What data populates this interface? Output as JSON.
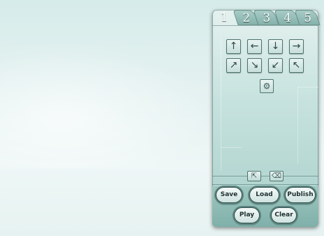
{
  "tabs": [
    {
      "label": "1",
      "active": true
    },
    {
      "label": "2",
      "active": false
    },
    {
      "label": "3",
      "active": false
    },
    {
      "label": "4",
      "active": false
    },
    {
      "label": "5",
      "active": false
    }
  ],
  "arrows": {
    "up": "↑",
    "left": "←",
    "down": "↓",
    "right": "→",
    "up_right": "↗",
    "down_right": "↘",
    "down_left": "↙",
    "up_left": "↖"
  },
  "tools": {
    "gear": "⚙",
    "reset": "⇱",
    "eraser": "⌫"
  },
  "buttons": {
    "save": "Save",
    "load": "Load",
    "publish": "Publish",
    "play": "Play",
    "clear": "Clear"
  },
  "colors": {
    "panel_border": "#4d726d",
    "pill_border": "#2f4f4b",
    "panel_bottom": "#7fb0a9"
  }
}
